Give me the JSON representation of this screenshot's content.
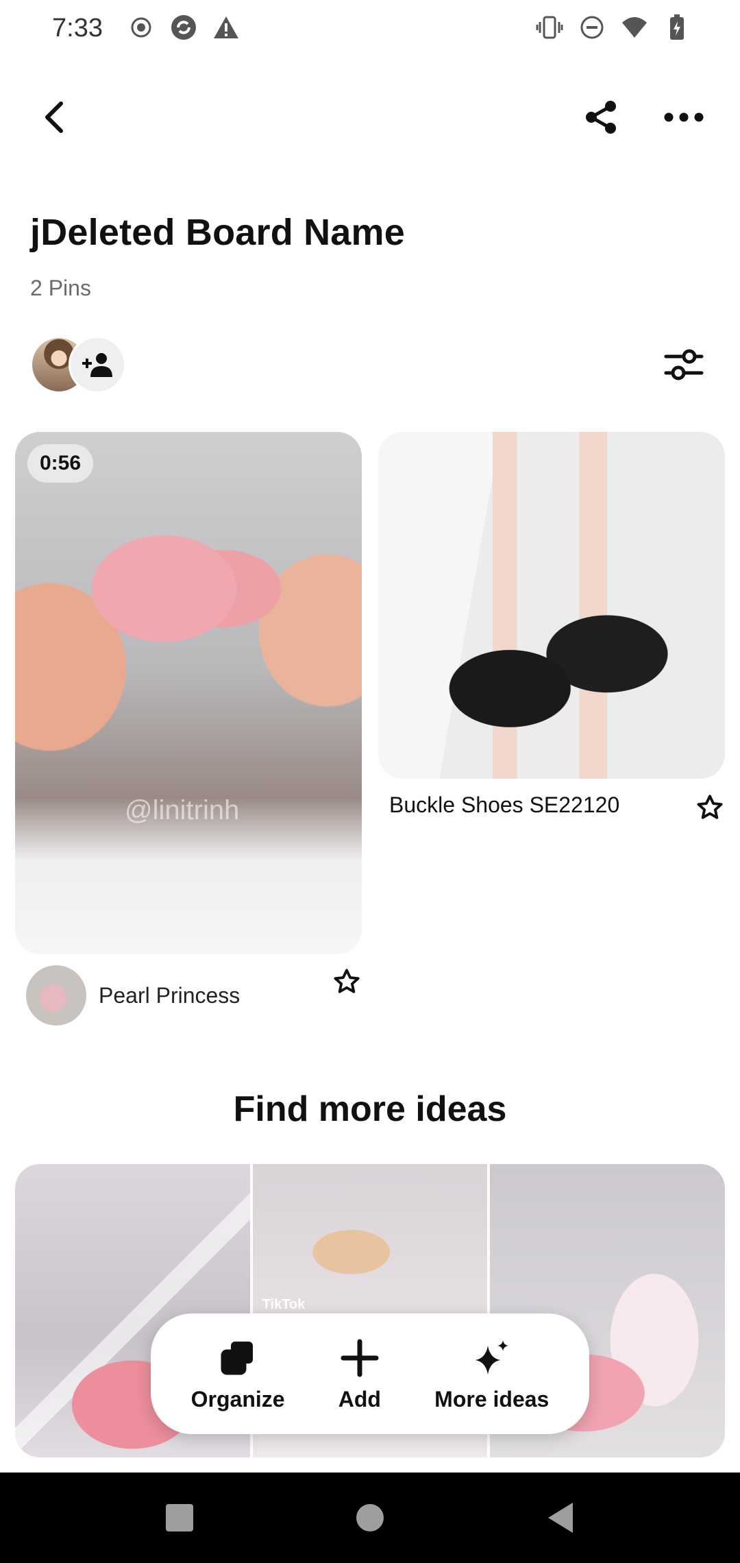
{
  "status_bar": {
    "time": "7:33",
    "icons_left": [
      "record-icon",
      "sync-icon",
      "warning-icon"
    ],
    "icons_right": [
      "vibrate-icon",
      "do-not-disturb-icon",
      "wifi-icon",
      "battery-charging-icon"
    ]
  },
  "board": {
    "title": "jDeleted Board Name",
    "pin_count": "2 Pins"
  },
  "pins": [
    {
      "duration": "0:56",
      "watermark": "@linitrinh",
      "author": "Pearl Princess"
    },
    {
      "title": "Buckle Shoes SE22120"
    }
  ],
  "find_more": {
    "title": "Find more ideas",
    "idea_tag": "TikTok"
  },
  "actions": {
    "organize": "Organize",
    "add": "Add",
    "more_ideas": "More ideas"
  },
  "colors": {
    "text_primary": "#111111",
    "text_secondary": "#6b6b6b",
    "nav_bg": "#000000"
  }
}
